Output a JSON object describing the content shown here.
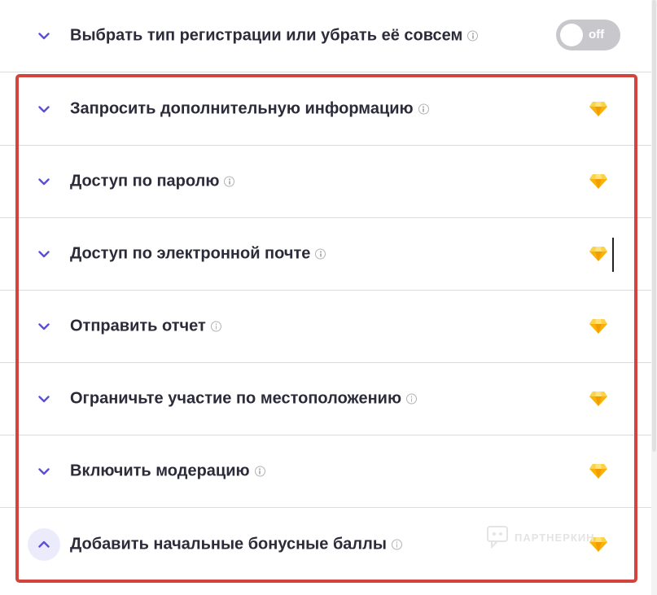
{
  "settings": {
    "rows": [
      {
        "label": "Выбрать тип регистрации или убрать её совсем",
        "trailing": "toggle",
        "toggle_text": "off",
        "expanded": false
      },
      {
        "label": "Запросить дополнительную информацию",
        "trailing": "gem-icon",
        "expanded": false
      },
      {
        "label": "Доступ по паролю",
        "trailing": "gem-icon",
        "expanded": false
      },
      {
        "label": "Доступ по электронной почте",
        "trailing": "gem-icon",
        "expanded": false
      },
      {
        "label": "Отправить отчет",
        "trailing": "gem-icon",
        "expanded": false
      },
      {
        "label": "Ограничьте участие по местоположению",
        "trailing": "gem-icon",
        "expanded": false
      },
      {
        "label": "Включить модерацию",
        "trailing": "gem-icon",
        "expanded": false
      },
      {
        "label": "Добавить начальные бонусные баллы",
        "trailing": "gem-icon",
        "expanded": true
      }
    ]
  },
  "watermark": {
    "text": "ПАРТНЕРКИН"
  },
  "colors": {
    "accent": "#5b4fd6",
    "highlight_border": "#d2443c",
    "gem_gold": "#f5b00a",
    "toggle_off": "#c7c7cc"
  }
}
